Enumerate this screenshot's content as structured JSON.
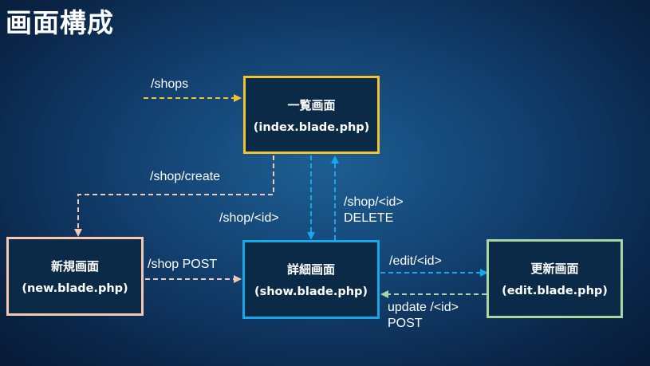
{
  "title": "画面構成",
  "nodes": {
    "index": {
      "name": "一覧画面",
      "file": "(index.blade.php)",
      "color": "#f2c230"
    },
    "new": {
      "name": "新規画面",
      "file": "(new.blade.php)",
      "color": "#f4c9b0"
    },
    "show": {
      "name": "詳細画面",
      "file": "(show.blade.php)",
      "color": "#16a8ea"
    },
    "edit": {
      "name": "更新画面",
      "file": "(edit.blade.php)",
      "color": "#a8d5a0"
    }
  },
  "edges": {
    "shops": "/shops",
    "create": "/shop/create",
    "show_link": "/shop/<id>",
    "delete_1": "/shop/<id>",
    "delete_2": "DELETE",
    "post": "/shop POST",
    "edit": "/edit/<id>",
    "update_1": "update /<id>",
    "update_2": "POST"
  },
  "colors": {
    "yellow": "#f2c230",
    "peach": "#f4c9b0",
    "blue": "#16a8ea",
    "green": "#a8d5a0"
  }
}
